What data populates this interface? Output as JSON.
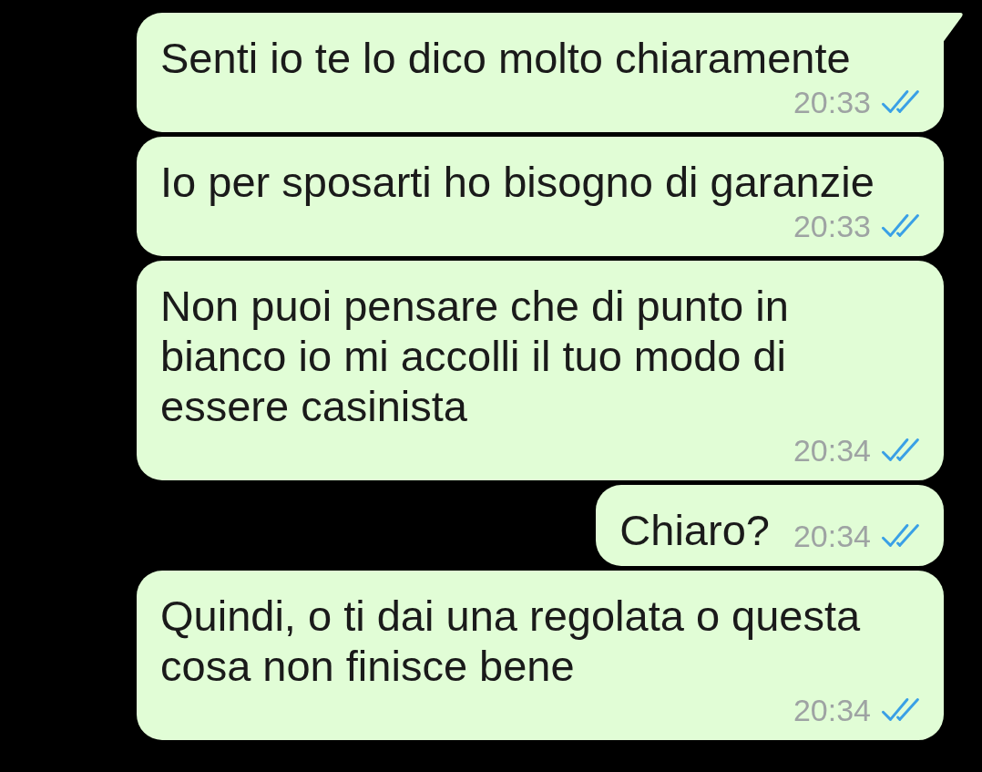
{
  "messages": [
    {
      "text": "Senti io te lo dico molto chiaramente",
      "time": "20:33",
      "read": true,
      "tail": true
    },
    {
      "text": "Io per sposarti ho bisogno di garanzie",
      "time": "20:33",
      "read": true,
      "tail": false
    },
    {
      "text": "Non puoi pensare che di punto in bianco io mi accolli il tuo modo di essere casinista",
      "time": "20:34",
      "read": true,
      "tail": false
    },
    {
      "text": "Chiaro?",
      "time": "20:34",
      "read": true,
      "tail": false
    },
    {
      "text": "Quindi, o ti dai una regolata o questa cosa non finisce bene",
      "time": "20:34",
      "read": true,
      "tail": false
    }
  ]
}
